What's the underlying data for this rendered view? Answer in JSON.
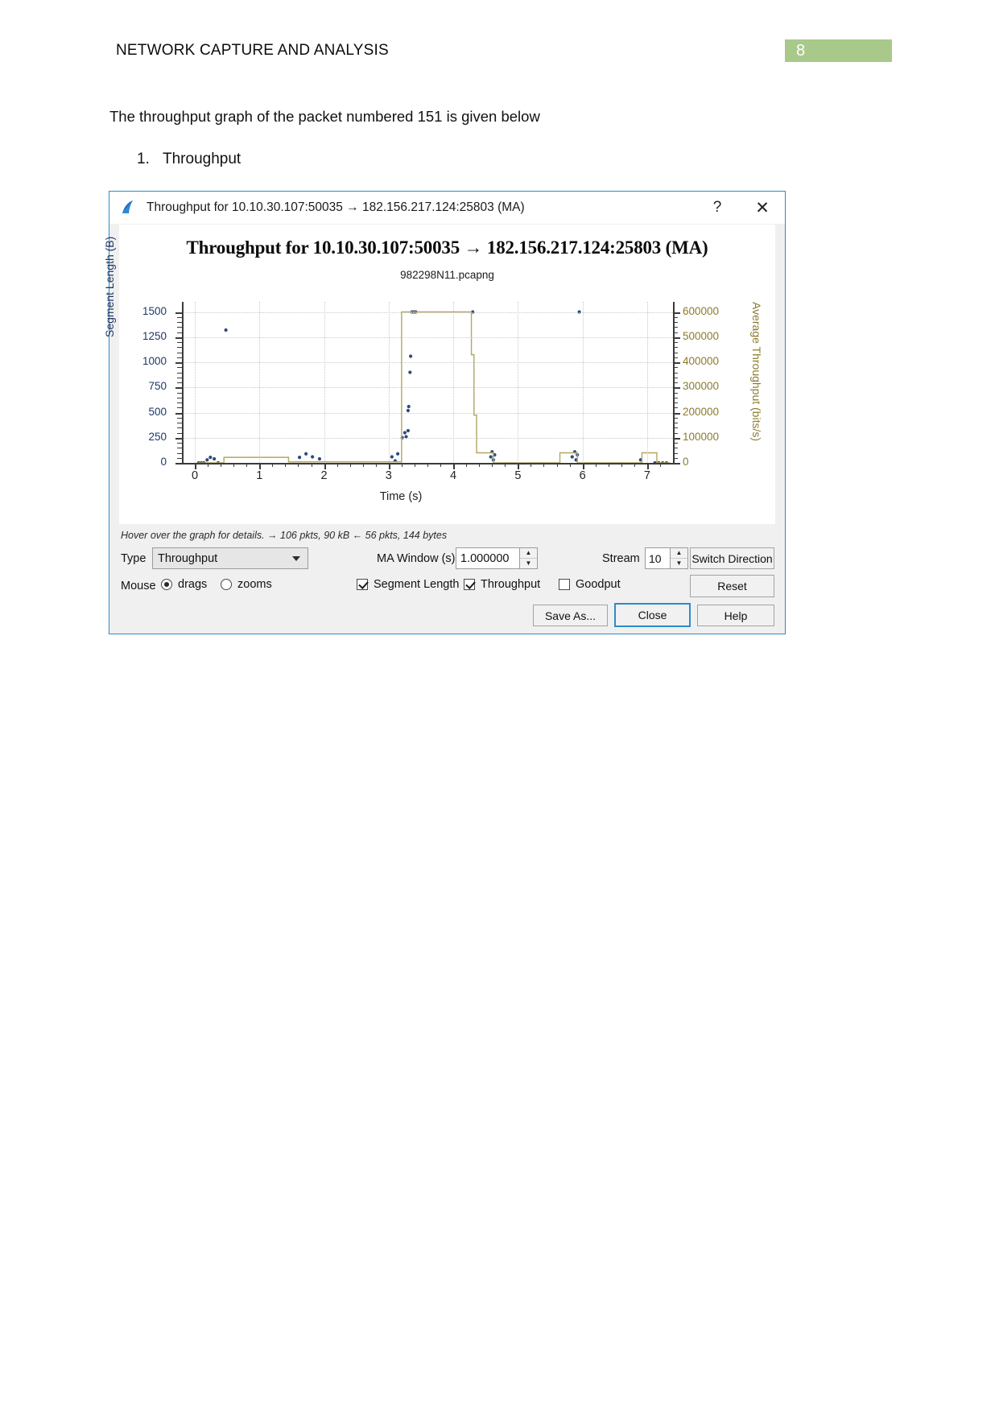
{
  "document": {
    "header_title": "NETWORK CAPTURE AND ANALYSIS",
    "page_number": "8",
    "intro_text": "The throughput graph of the packet numbered 151 is given below",
    "list_number": "1.",
    "list_label": "Throughput",
    "accent_green": "#a9c98b"
  },
  "dialog": {
    "titlebar": {
      "icon": "wireshark-fin-icon",
      "title": "Throughput for 10.10.30.107:50035 → 182.156.217.124:25803 (MA)",
      "help_label": "?",
      "close_label": "✕"
    },
    "hover_hint": "Hover over the graph for details. → 106 pkts, 90 kB ← 56 pkts, 144 bytes",
    "controls": {
      "type_label": "Type",
      "type_value": "Throughput",
      "ma_window_label": "MA Window (s)",
      "ma_window_value": "1.000000",
      "stream_label": "Stream",
      "stream_value": "10",
      "switch_direction_label": "Switch Direction",
      "mouse_label": "Mouse",
      "mouse_drags_label": "drags",
      "mouse_zooms_label": "zooms",
      "mouse_selected": "drags",
      "cb_segment_length_label": "Segment Length",
      "cb_throughput_label": "Throughput",
      "cb_goodput_label": "Goodput",
      "cb_segment_length_checked": true,
      "cb_throughput_checked": true,
      "cb_goodput_checked": false,
      "reset_label": "Reset",
      "save_as_label": "Save As...",
      "close_label": "Close",
      "help_label": "Help"
    }
  },
  "chart_data": {
    "type": "scatter",
    "title": "Throughput for 10.10.30.107:50035 → 182.156.217.124:25803 (MA)",
    "subtitle": "982298N11.pcapng",
    "xlabel": "Time (s)",
    "ylabel": "Segment Length (B)",
    "ylabel_right": "Average Throughput (bits/s)",
    "grid": true,
    "legend": "none",
    "xlim": [
      -0.2,
      7.4
    ],
    "xticks": [
      "0",
      "1",
      "2",
      "3",
      "4",
      "5",
      "6",
      "7"
    ],
    "ylim": [
      0,
      1600
    ],
    "yticks": [
      "1500",
      "1250",
      "1000",
      "750",
      "500",
      "250",
      "0"
    ],
    "ylim_right": [
      0,
      640000
    ],
    "yticks_right": [
      "600000",
      "500000",
      "400000",
      "300000",
      "200000",
      "100000",
      "0"
    ],
    "series": [
      {
        "name": "Segment Length",
        "type": "scatter",
        "color": "#2e4a7d",
        "axis": "left",
        "points": [
          [
            0.06,
            0
          ],
          [
            0.1,
            0
          ],
          [
            0.14,
            0
          ],
          [
            0.19,
            30
          ],
          [
            0.24,
            55
          ],
          [
            0.3,
            40
          ],
          [
            0.36,
            0
          ],
          [
            0.48,
            1320
          ],
          [
            1.62,
            55
          ],
          [
            1.72,
            90
          ],
          [
            1.82,
            60
          ],
          [
            1.93,
            40
          ],
          [
            3.05,
            60
          ],
          [
            3.1,
            20
          ],
          [
            3.14,
            90
          ],
          [
            3.21,
            250
          ],
          [
            3.25,
            300
          ],
          [
            3.27,
            260
          ],
          [
            3.3,
            320
          ],
          [
            3.3,
            520
          ],
          [
            3.31,
            560
          ],
          [
            3.33,
            900
          ],
          [
            3.34,
            1060
          ],
          [
            3.36,
            1500
          ],
          [
            3.39,
            1500
          ],
          [
            3.42,
            1500
          ],
          [
            4.3,
            1500
          ],
          [
            4.58,
            60
          ],
          [
            4.6,
            110
          ],
          [
            4.62,
            30
          ],
          [
            4.64,
            80
          ],
          [
            5.84,
            60
          ],
          [
            5.88,
            110
          ],
          [
            5.9,
            30
          ],
          [
            5.92,
            80
          ],
          [
            5.95,
            1500
          ],
          [
            6.9,
            30
          ],
          [
            7.12,
            0
          ],
          [
            7.18,
            0
          ],
          [
            7.24,
            0
          ],
          [
            7.3,
            0
          ]
        ]
      },
      {
        "name": "Average Throughput (MA)",
        "type": "step",
        "color": "#b2a664",
        "axis": "right",
        "points": [
          [
            0.05,
            0
          ],
          [
            0.45,
            0
          ],
          [
            0.45,
            22000
          ],
          [
            1.45,
            22000
          ],
          [
            1.45,
            4000
          ],
          [
            3.2,
            4000
          ],
          [
            3.2,
            600000
          ],
          [
            4.28,
            600000
          ],
          [
            4.28,
            430000
          ],
          [
            4.32,
            430000
          ],
          [
            4.32,
            190000
          ],
          [
            4.36,
            190000
          ],
          [
            4.36,
            40000
          ],
          [
            4.62,
            40000
          ],
          [
            4.62,
            0
          ],
          [
            5.65,
            0
          ],
          [
            5.65,
            40000
          ],
          [
            5.92,
            40000
          ],
          [
            5.92,
            0
          ],
          [
            6.92,
            0
          ],
          [
            6.92,
            40000
          ],
          [
            7.15,
            40000
          ],
          [
            7.15,
            0
          ],
          [
            7.35,
            0
          ]
        ]
      }
    ]
  }
}
